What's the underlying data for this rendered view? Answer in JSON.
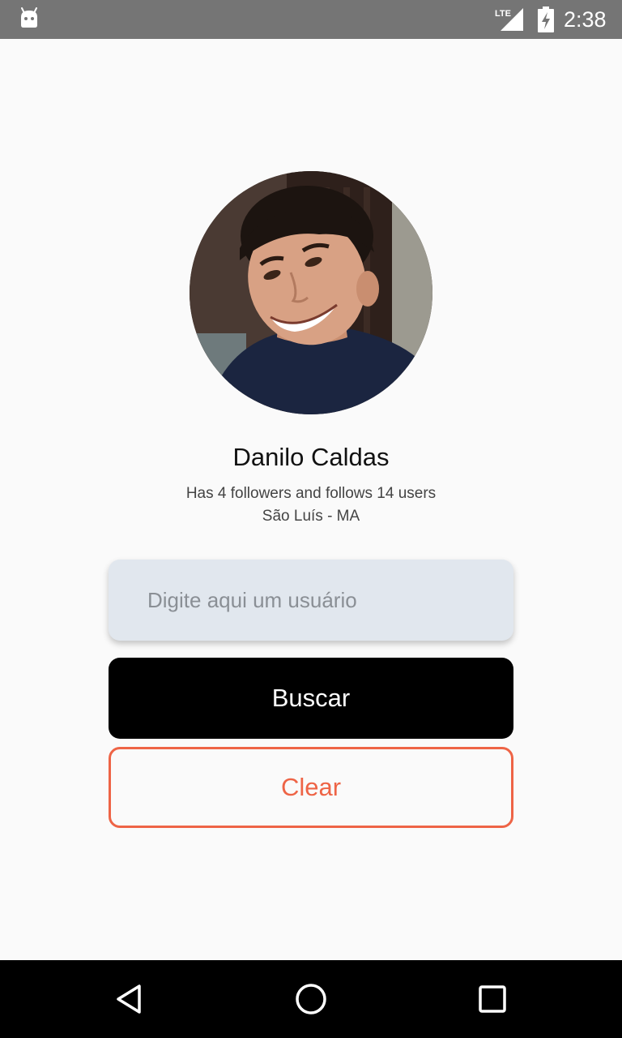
{
  "status_bar": {
    "time": "2:38",
    "network": "LTE",
    "icons": [
      "android-icon",
      "lte-signal-icon",
      "battery-charging-icon"
    ]
  },
  "profile": {
    "name": "Danilo Caldas",
    "stats": "Has 4 followers and follows 14 users",
    "location": "São Luís - MA"
  },
  "search": {
    "placeholder": "Digite aqui um usuário",
    "value": ""
  },
  "buttons": {
    "search_label": "Buscar",
    "clear_label": "Clear"
  },
  "nav_bar": {
    "icons": [
      "back-icon",
      "home-icon",
      "recents-icon"
    ]
  },
  "colors": {
    "status_bar": "#757575",
    "background": "#fafafa",
    "input_background": "#e1e7ee",
    "primary_button": "#000000",
    "accent": "#ee6446",
    "nav_bar": "#000000"
  }
}
